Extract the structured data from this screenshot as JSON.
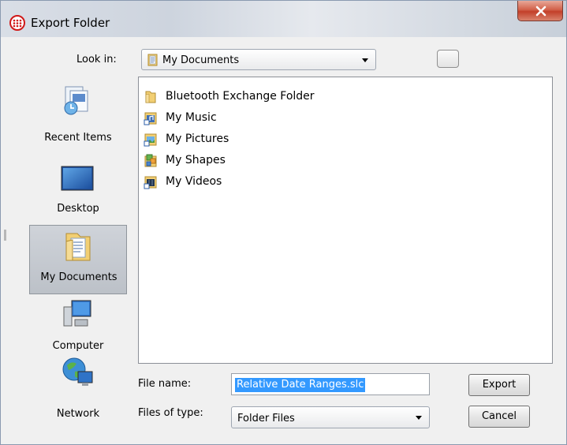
{
  "window": {
    "title": "Export Folder"
  },
  "look_in": {
    "label": "Look in:",
    "value": "My Documents"
  },
  "places": [
    {
      "label": "Recent Items",
      "icon": "recent-items-icon"
    },
    {
      "label": "Desktop",
      "icon": "desktop-icon"
    },
    {
      "label": "My Documents",
      "icon": "my-documents-icon",
      "selected": true
    },
    {
      "label": "Computer",
      "icon": "computer-icon"
    },
    {
      "label": "Network",
      "icon": "network-icon"
    }
  ],
  "files": [
    {
      "name": "Bluetooth Exchange Folder",
      "icon": "folder-icon"
    },
    {
      "name": "My Music",
      "icon": "music-folder-icon"
    },
    {
      "name": "My Pictures",
      "icon": "pictures-folder-icon"
    },
    {
      "name": "My Shapes",
      "icon": "shapes-folder-icon"
    },
    {
      "name": "My Videos",
      "icon": "videos-folder-icon"
    }
  ],
  "file_name": {
    "label": "File name:",
    "value": "Relative Date Ranges.slc"
  },
  "file_type": {
    "label": "Files of type:",
    "value": "Folder Files"
  },
  "buttons": {
    "export": "Export",
    "cancel": "Cancel"
  },
  "colors": {
    "selection": "#3399ff",
    "close_button": "#c2402a"
  }
}
